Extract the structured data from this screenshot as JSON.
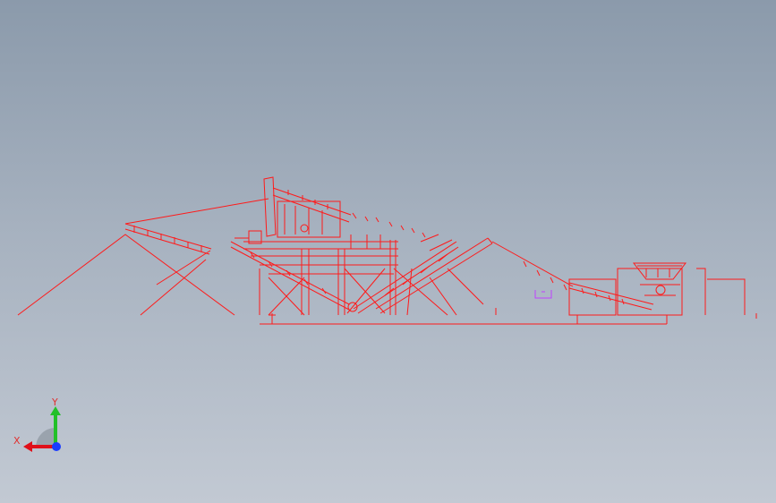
{
  "colors": {
    "model_lines": "#ff1a1a",
    "marker": "#c040ff",
    "axis_x": "#e0101a",
    "axis_y": "#22c028",
    "axis_z": "#1a3cff",
    "triad_shade": "#9aa3ad",
    "axis_label": "#e03030"
  },
  "triad": {
    "x_label": "X",
    "y_label": "Y"
  }
}
